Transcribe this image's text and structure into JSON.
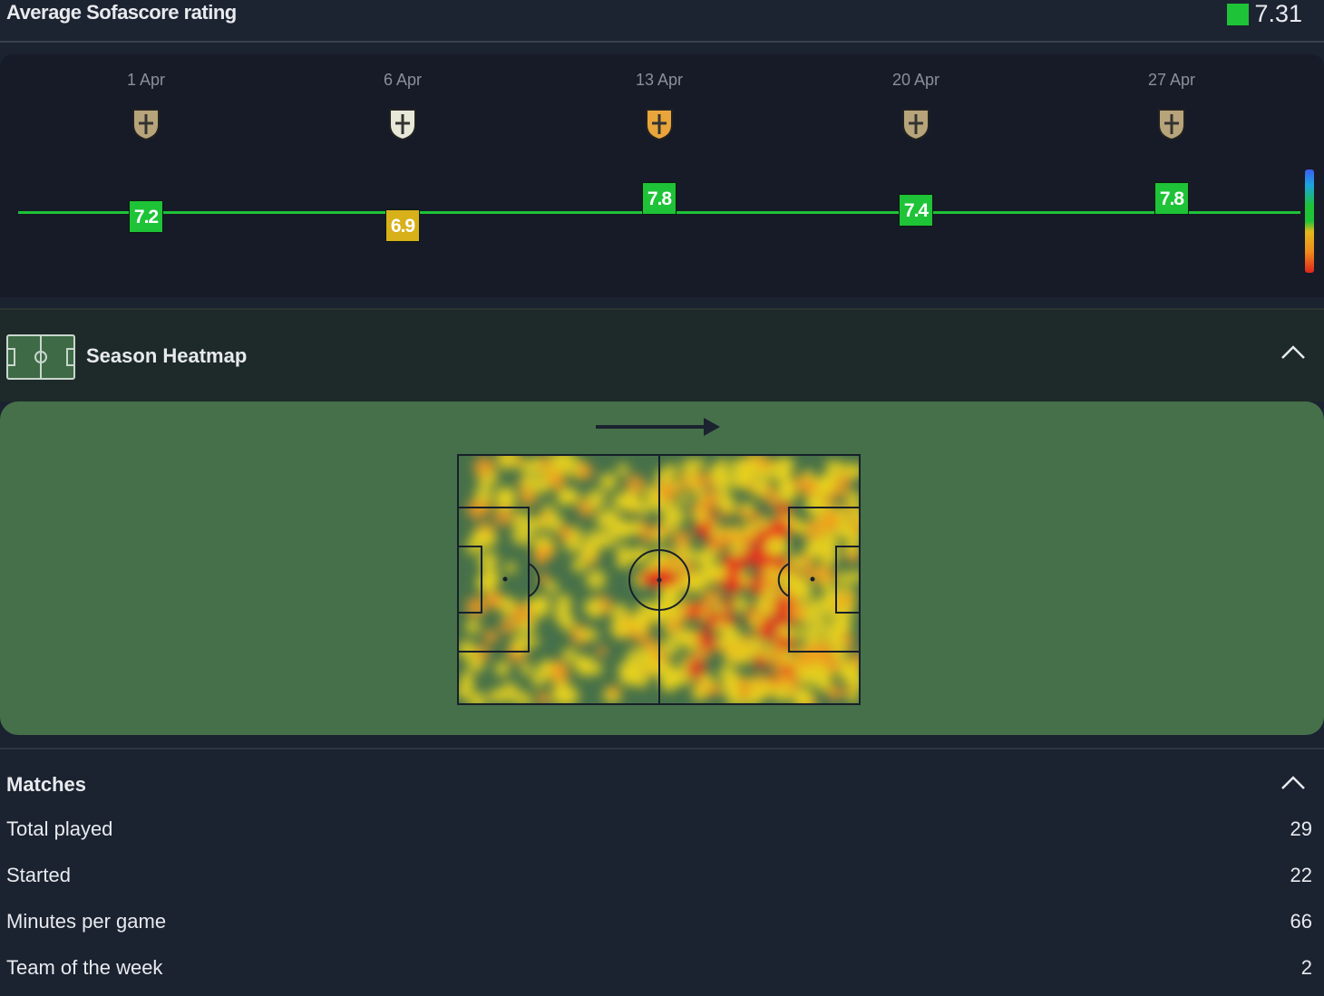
{
  "header": {
    "title": "Average Sofascore rating",
    "average": "7.31"
  },
  "ratings": [
    {
      "date": "1 Apr",
      "rating": 7.2,
      "label": "7.2",
      "color": "#1ec337",
      "crest": "notts-county-crest"
    },
    {
      "date": "6 Apr",
      "rating": 6.9,
      "label": "6.9",
      "color": "#d8b01a",
      "crest": "forest-green-crest"
    },
    {
      "date": "13 Apr",
      "rating": 7.8,
      "label": "7.8",
      "color": "#1ec337",
      "crest": "mansfield-crest"
    },
    {
      "date": "20 Apr",
      "rating": 7.4,
      "label": "7.4",
      "color": "#1ec337",
      "crest": "newport-crest"
    },
    {
      "date": "27 Apr",
      "rating": 7.8,
      "label": "7.8",
      "color": "#1ec337",
      "crest": "sutton-crest"
    }
  ],
  "heatmap": {
    "title": "Season Heatmap"
  },
  "matches": {
    "title": "Matches",
    "rows": [
      {
        "label": "Total played",
        "value": "29"
      },
      {
        "label": "Started",
        "value": "22"
      },
      {
        "label": "Minutes per game",
        "value": "66"
      },
      {
        "label": "Team of the week",
        "value": "2"
      }
    ]
  }
}
